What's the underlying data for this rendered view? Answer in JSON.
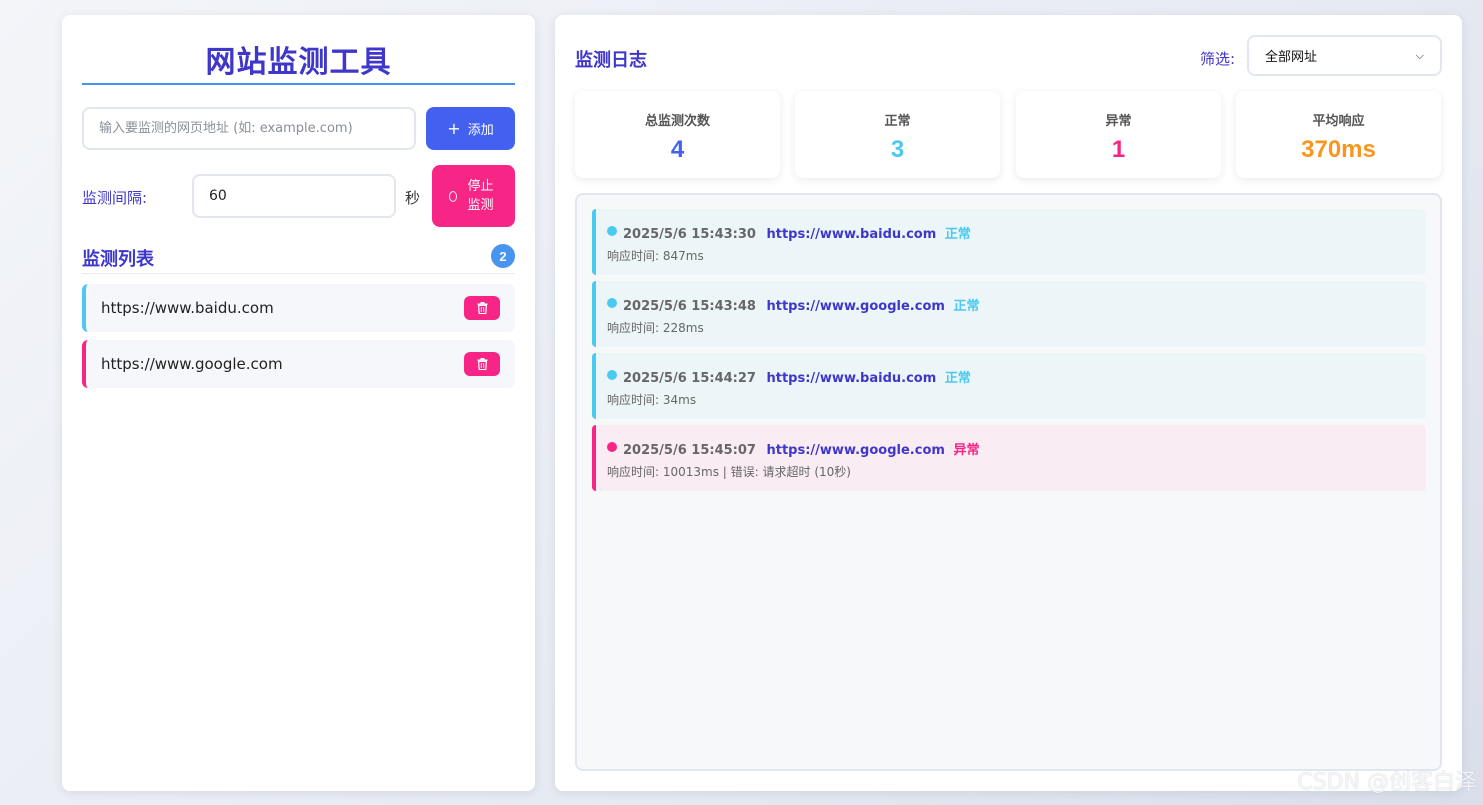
{
  "app": {
    "title": "网站监测工具"
  },
  "add": {
    "placeholder": "输入要监测的网页地址 (如: example.com)",
    "value": "",
    "button_label": "添加",
    "button_icon": "plus-icon"
  },
  "interval": {
    "label": "监测间隔:",
    "value": "60",
    "unit": "秒",
    "stop_label": "停止监测",
    "stop_icon": "spinner-icon"
  },
  "monitor_list": {
    "title": "监测列表",
    "count": "2",
    "items": [
      {
        "url": "https://www.baidu.com",
        "status": "normal",
        "delete_icon": "trash-icon"
      },
      {
        "url": "https://www.google.com",
        "status": "error",
        "delete_icon": "trash-icon"
      }
    ]
  },
  "log": {
    "title": "监测日志",
    "filter_label": "筛选:",
    "filter_selected": "全部网址",
    "stats": [
      {
        "label": "总监测次数",
        "value": "4",
        "color": "#4361ee"
      },
      {
        "label": "正常",
        "value": "3",
        "color": "#4cc9f0"
      },
      {
        "label": "异常",
        "value": "1",
        "color": "#f72585"
      },
      {
        "label": "平均响应",
        "value": "370ms",
        "color": "#f8961e"
      }
    ],
    "entries": [
      {
        "time": "2025/5/6 15:43:30",
        "url": "https://www.baidu.com",
        "status": "正常",
        "detail": "响应时间: 847ms",
        "ok": true
      },
      {
        "time": "2025/5/6 15:43:48",
        "url": "https://www.google.com",
        "status": "正常",
        "detail": "响应时间: 228ms",
        "ok": true
      },
      {
        "time": "2025/5/6 15:44:27",
        "url": "https://www.baidu.com",
        "status": "正常",
        "detail": "响应时间: 34ms",
        "ok": true
      },
      {
        "time": "2025/5/6 15:45:07",
        "url": "https://www.google.com",
        "status": "异常",
        "detail": "响应时间: 10013ms | 错误: 请求超时 (10秒)",
        "ok": false
      }
    ]
  },
  "colors": {
    "primary": "#4361ee",
    "title": "#3f37c9",
    "success": "#4cc9f0",
    "danger": "#f72585",
    "warning": "#f8961e"
  },
  "watermark": "CSDN @创客白泽"
}
